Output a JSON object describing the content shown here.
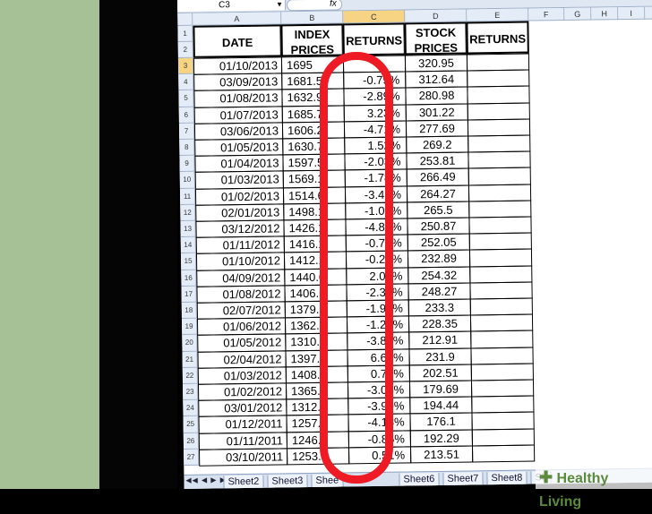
{
  "name_box": "C3",
  "formula_label": "fx",
  "columns": [
    "A",
    "B",
    "C",
    "D",
    "E",
    "F",
    "G",
    "H",
    "I",
    "J"
  ],
  "headers": {
    "date": "DATE",
    "index_prices": "INDEX PRICES",
    "returns": "RETURNS",
    "stock_prices": "STOCK PRICES",
    "returns2": "RETURNS"
  },
  "row_numbers": [
    "1",
    "2",
    "3",
    "4",
    "5",
    "6",
    "7",
    "8",
    "9",
    "10",
    "11",
    "12",
    "13",
    "14",
    "15",
    "16",
    "17",
    "18",
    "19",
    "20",
    "21",
    "22",
    "23",
    "24",
    "25",
    "26",
    "27"
  ],
  "rows": [
    {
      "date": "01/10/2013",
      "index": "1695",
      "returns": "",
      "stock": "320.95"
    },
    {
      "date": "03/09/2013",
      "index": "1681.5",
      "returns": "-0.79%",
      "stock": "312.64"
    },
    {
      "date": "01/08/2013",
      "index": "1632.9",
      "returns": "-2.89%",
      "stock": "280.98"
    },
    {
      "date": "01/07/2013",
      "index": "1685.7",
      "returns": "3.23%",
      "stock": "301.22"
    },
    {
      "date": "03/06/2013",
      "index": "1606.2",
      "returns": "-4.71%",
      "stock": "277.69"
    },
    {
      "date": "01/05/2013",
      "index": "1630.7",
      "returns": "1.52%",
      "stock": "269.2"
    },
    {
      "date": "01/04/2013",
      "index": "1597.5",
      "returns": "-2.03%",
      "stock": "253.81"
    },
    {
      "date": "01/03/2013",
      "index": "1569.1",
      "returns": "-1.78%",
      "stock": "266.49"
    },
    {
      "date": "01/02/2013",
      "index": "1514.6",
      "returns": "-3.47%",
      "stock": "264.27"
    },
    {
      "date": "02/01/2013",
      "index": "1498.1",
      "returns": "-1.09%",
      "stock": "265.5"
    },
    {
      "date": "03/12/2012",
      "index": "1426.1",
      "returns": "-4.80%",
      "stock": "250.87"
    },
    {
      "date": "01/11/2012",
      "index": "1416.1",
      "returns": "-0.70%",
      "stock": "252.05"
    },
    {
      "date": "01/10/2012",
      "index": "1412.1",
      "returns": "-0.28%",
      "stock": "232.89"
    },
    {
      "date": "04/09/2012",
      "index": "1440.6",
      "returns": "2.02%",
      "stock": "254.32"
    },
    {
      "date": "01/08/2012",
      "index": "1406.5",
      "returns": "-2.37%",
      "stock": "248.27"
    },
    {
      "date": "02/07/2012",
      "index": "1379.3",
      "returns": "-1.94%",
      "stock": "233.3"
    },
    {
      "date": "01/06/2012",
      "index": "1362.1",
      "returns": "-1.24%",
      "stock": "228.35"
    },
    {
      "date": "01/05/2012",
      "index": "1310.3",
      "returns": "-3.80%",
      "stock": "212.91"
    },
    {
      "date": "02/04/2012",
      "index": "1397.9",
      "returns": "6.68%",
      "stock": "231.9"
    },
    {
      "date": "01/03/2012",
      "index": "1408.4",
      "returns": "0.76%",
      "stock": "202.51"
    },
    {
      "date": "01/02/2012",
      "index": "1365.6",
      "returns": "-3.04%",
      "stock": "179.69"
    },
    {
      "date": "03/01/2012",
      "index": "1312.4",
      "returns": "-3.90%",
      "stock": "194.44"
    },
    {
      "date": "01/12/2011",
      "index": "1257.6",
      "returns": "-4.18%",
      "stock": "176.1"
    },
    {
      "date": "01/11/2011",
      "index": "1246.9",
      "returns": "-0.85%",
      "stock": "192.29"
    },
    {
      "date": "03/10/2011",
      "index": "1253.3",
      "returns": "0.51%",
      "stock": "213.51"
    }
  ],
  "sheet_tabs": [
    "Sheet2",
    "Sheet3",
    "Shee",
    "Sheet6",
    "Sheet7",
    "Sheet8",
    "Sh"
  ],
  "tab_nav": "◀◀ ◀ ▶ ▶▶",
  "watermark": "Healthy Living",
  "colors": {
    "highlight": "#ee1b24",
    "header_selected": "#f7d483",
    "watermark": "#5b8a3c"
  }
}
